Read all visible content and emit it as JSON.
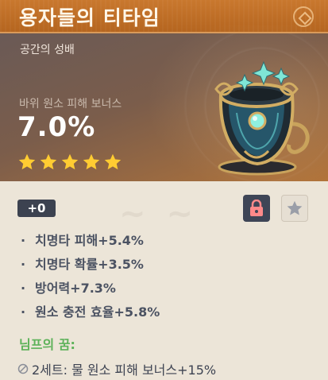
{
  "artifact": {
    "name": "용자들의 티타임",
    "slot_type": "공간의 성배",
    "main_stat": {
      "name": "바위 원소 피해 보너스",
      "value": "7.0%"
    },
    "rarity_stars": 5,
    "level": "+0",
    "locked": true,
    "substats": [
      "치명타 피해+5.4%",
      "치명타 확률+3.5%",
      "방어력+7.3%",
      "원소 충전 효율+5.8%"
    ],
    "set": {
      "name": "님프의 꿈:",
      "bonus_2": "2세트: 물 원소 피해 보너스+15%"
    }
  },
  "icons": {
    "star": "star-icon",
    "lock": "lock-icon",
    "favorite": "favorite-star-icon",
    "set_inactive": "set-inactive-icon"
  },
  "colors": {
    "title_bar": "#c9782e",
    "star": "#ffcc32",
    "set_name": "#5eb25a",
    "lock_icon": "#ff8a8a",
    "panel_bg": "#ece5d8"
  }
}
